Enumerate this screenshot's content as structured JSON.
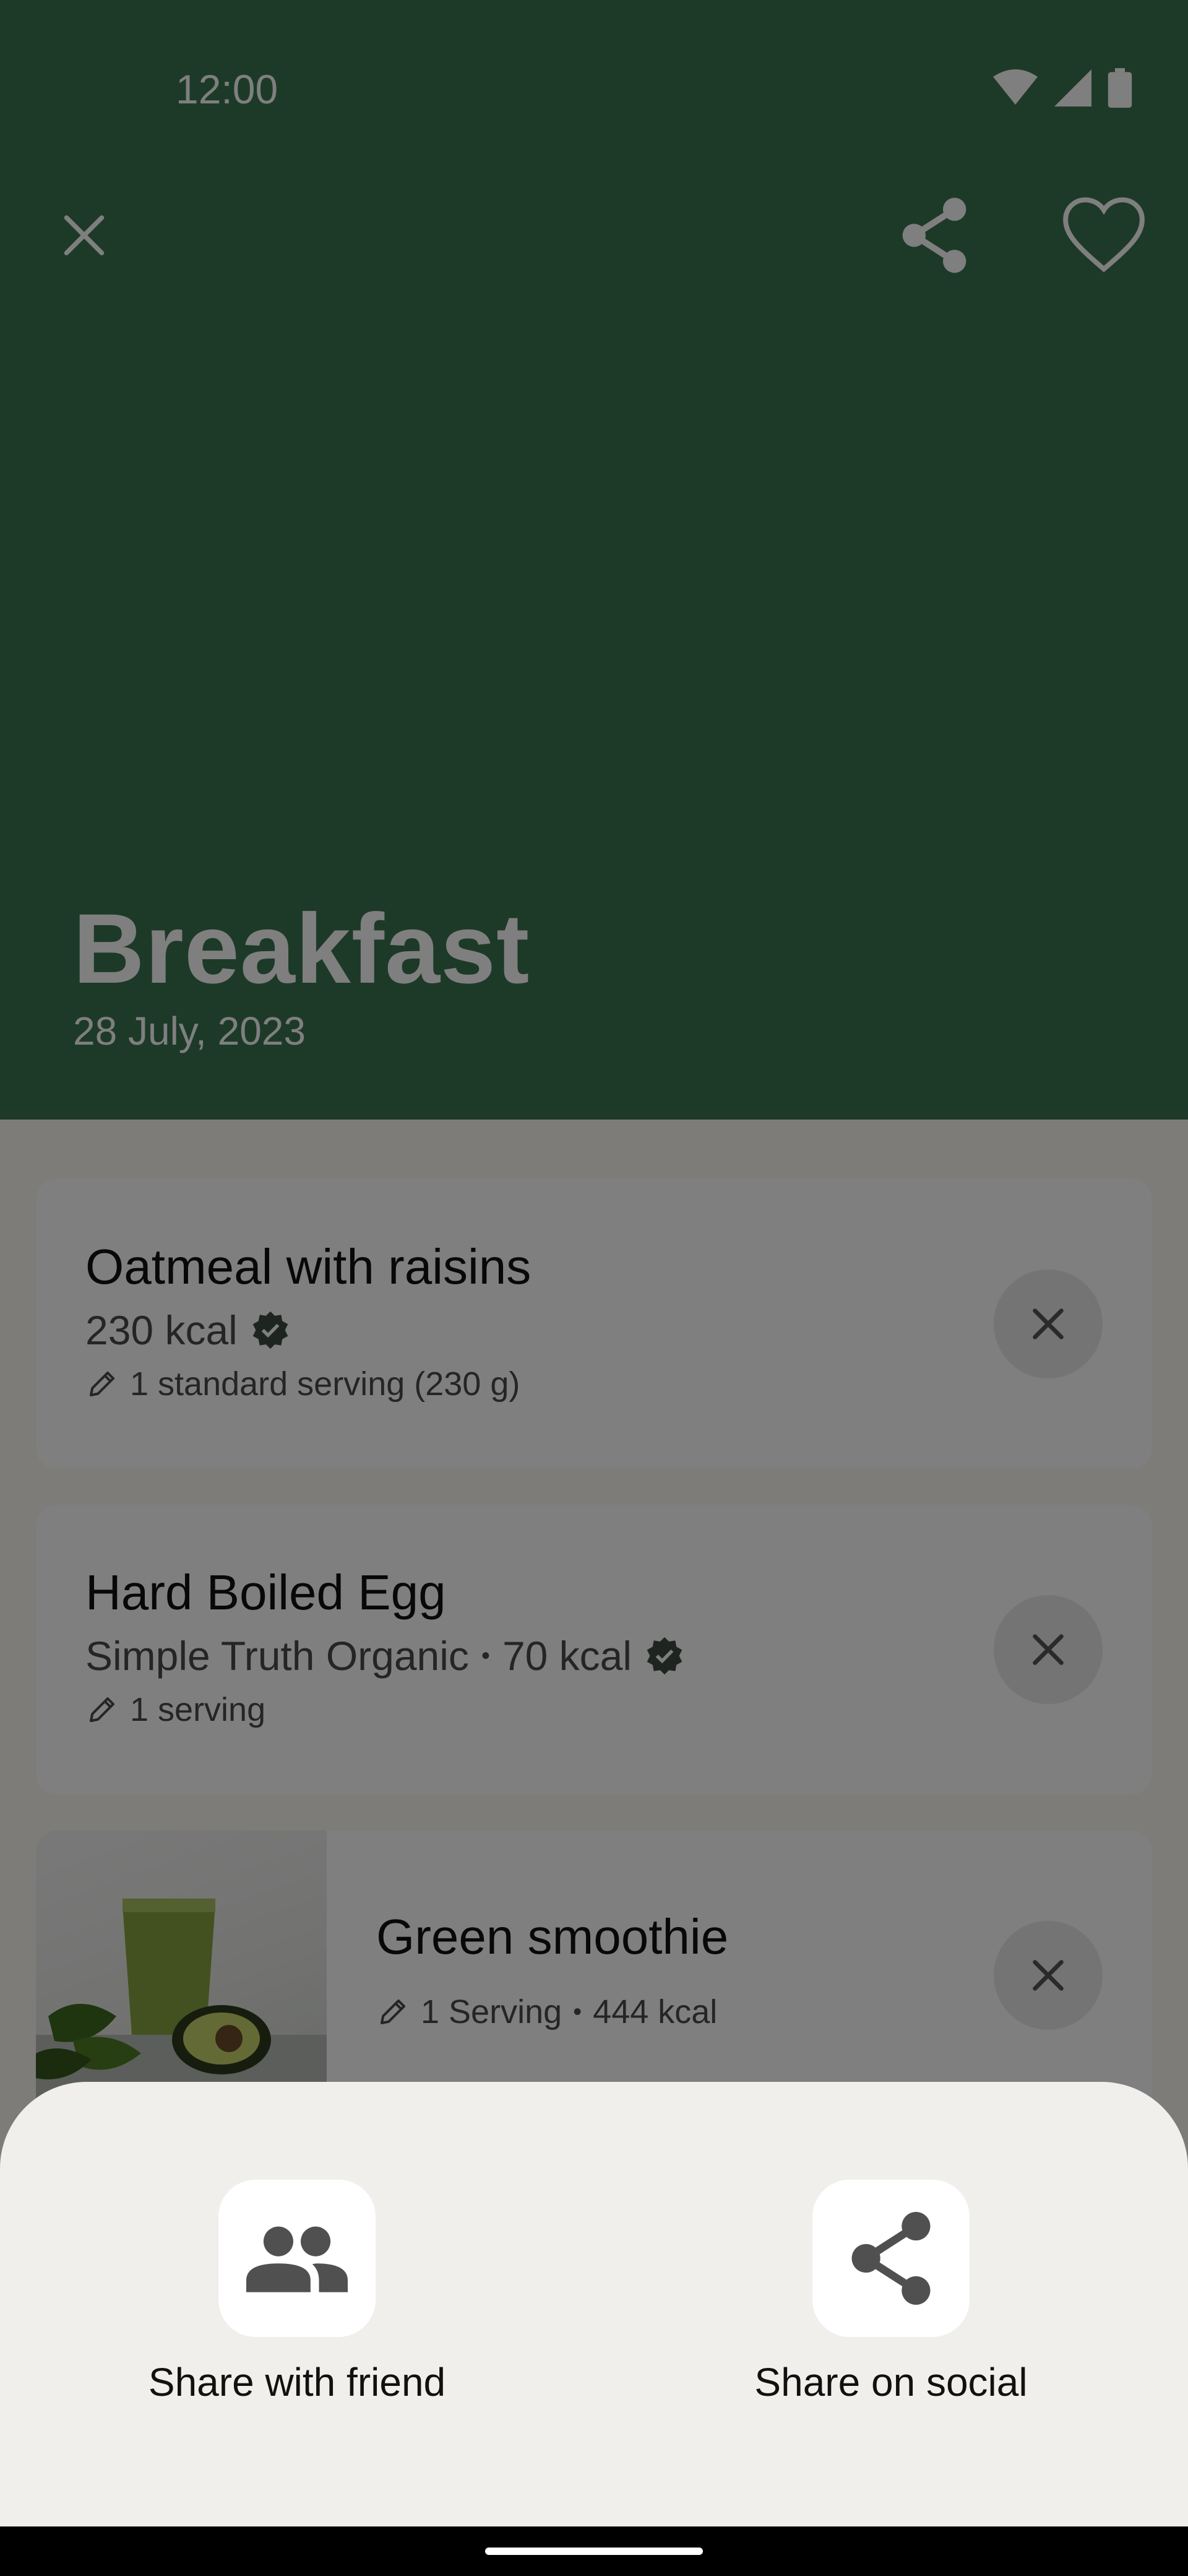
{
  "status_bar": {
    "time": "12:00"
  },
  "toolbar": {
    "close_icon": "close-icon",
    "share_icon": "share-icon",
    "favorite_icon": "heart-outline-icon"
  },
  "meal": {
    "title": "Breakfast",
    "date": "28 July, 2023"
  },
  "items": [
    {
      "name": "Oatmeal with raisins",
      "kcal": "230 kcal",
      "serving": "1 standard serving (230 g)",
      "verified": true
    },
    {
      "name": "Hard Boiled Egg",
      "brand": "Simple Truth Organic",
      "kcal": "70 kcal",
      "serving": "1 serving",
      "verified": true
    },
    {
      "name": "Green smoothie",
      "serving": "1 Serving",
      "kcal": "444 kcal"
    }
  ],
  "share_sheet": {
    "options": [
      {
        "label": "Share with friend",
        "icon": "people-icon"
      },
      {
        "label": "Share on social",
        "icon": "share-icon"
      }
    ]
  },
  "colors": {
    "header": "#3a7451",
    "content_bg": "#fbf8f3",
    "sheet_bg": "#f1efeb"
  }
}
